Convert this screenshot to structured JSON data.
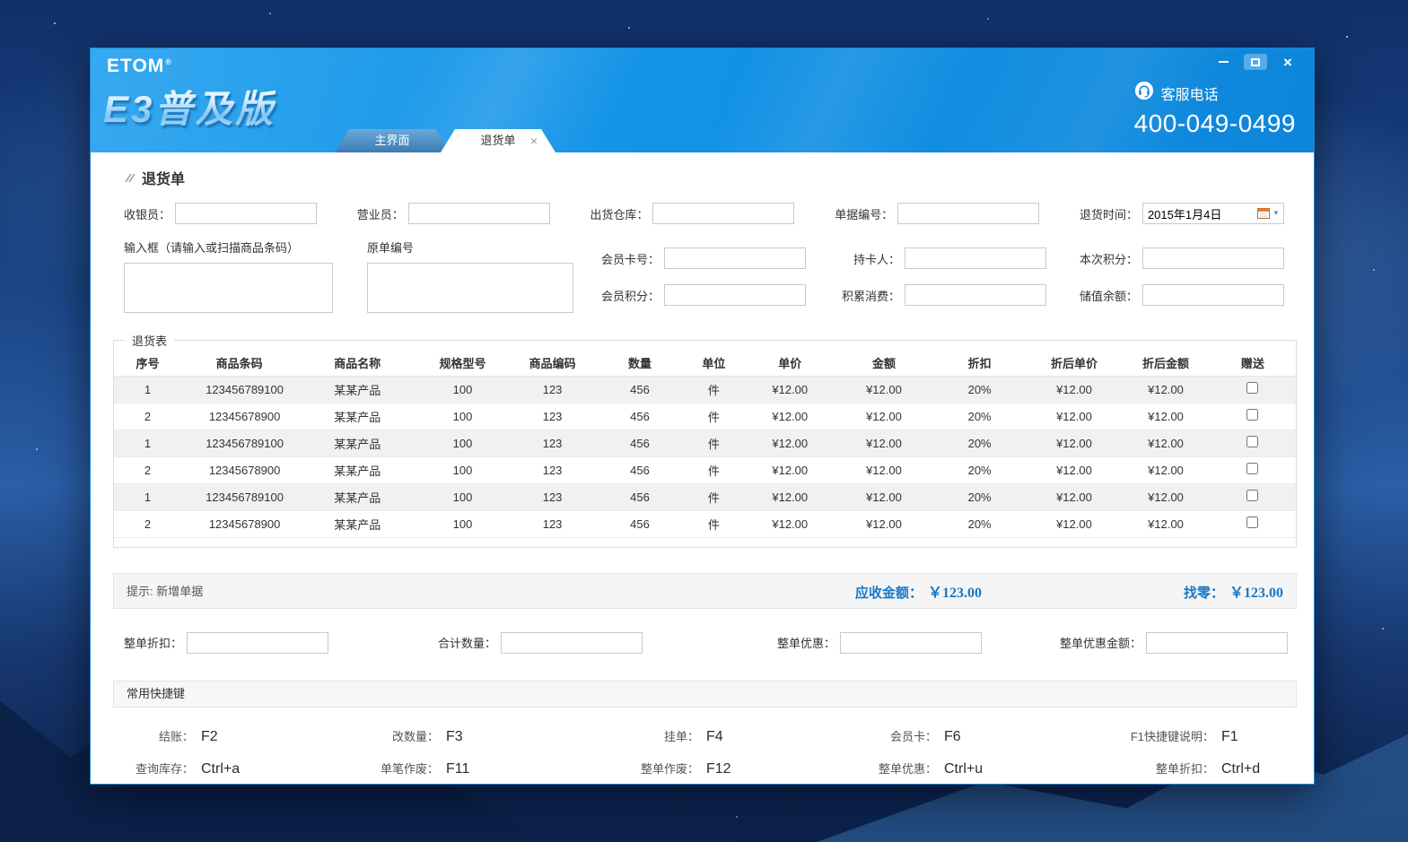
{
  "colors": {
    "header_blue": "#1494e8",
    "amount_blue": "#1779c8"
  },
  "icons": {
    "window_close": "×",
    "tab_close": "×",
    "date_caret": "▼"
  },
  "window": {
    "logo": "ETOM",
    "logo_reg": "®",
    "brand": "E3普及版",
    "service": {
      "label": "客服电话",
      "phone": "400-049-0499"
    },
    "tabs": [
      {
        "label": "主界面",
        "active": false
      },
      {
        "label": "退货单",
        "active": true
      }
    ]
  },
  "page": {
    "title": "退货单"
  },
  "form": {
    "cashier_label": "收银员：",
    "salesperson_label": "营业员：",
    "warehouse_label": "出货仓库：",
    "doc_no_label": "单据编号：",
    "return_time_label": "退货时间：",
    "return_time_value": "2015年1月4日",
    "barcode_box_label": "输入框（请输入或扫描商品条码）",
    "original_no_label": "原单编号",
    "member_card_label": "会员卡号：",
    "cardholder_label": "持卡人：",
    "current_points_label": "本次积分：",
    "member_points_label": "会员积分：",
    "accumulated_label": "积累消费：",
    "stored_balance_label": "储值余额："
  },
  "table": {
    "title": "退货表",
    "headers": [
      "序号",
      "商品条码",
      "商品名称",
      "规格型号",
      "商品编码",
      "数量",
      "单位",
      "单价",
      "金额",
      "折扣",
      "折后单价",
      "折后金额",
      "赠送"
    ],
    "rows": [
      [
        "1",
        "123456789100",
        "某某产品",
        "100",
        "123",
        "456",
        "件",
        "¥12.00",
        "¥12.00",
        "20%",
        "¥12.00",
        "¥12.00"
      ],
      [
        "2",
        "12345678900",
        "某某产品",
        "100",
        "123",
        "456",
        "件",
        "¥12.00",
        "¥12.00",
        "20%",
        "¥12.00",
        "¥12.00"
      ],
      [
        "1",
        "123456789100",
        "某某产品",
        "100",
        "123",
        "456",
        "件",
        "¥12.00",
        "¥12.00",
        "20%",
        "¥12.00",
        "¥12.00"
      ],
      [
        "2",
        "12345678900",
        "某某产品",
        "100",
        "123",
        "456",
        "件",
        "¥12.00",
        "¥12.00",
        "20%",
        "¥12.00",
        "¥12.00"
      ],
      [
        "1",
        "123456789100",
        "某某产品",
        "100",
        "123",
        "456",
        "件",
        "¥12.00",
        "¥12.00",
        "20%",
        "¥12.00",
        "¥12.00"
      ],
      [
        "2",
        "12345678900",
        "某某产品",
        "100",
        "123",
        "456",
        "件",
        "¥12.00",
        "¥12.00",
        "20%",
        "¥12.00",
        "¥12.00"
      ]
    ]
  },
  "status": {
    "hint": "提示: 新增单据",
    "receivable_label": "应收金额：",
    "receivable_value": "￥123.00",
    "change_label": "找零：",
    "change_value": "￥123.00"
  },
  "totals": {
    "order_discount_label": "整单折扣：",
    "total_qty_label": "合计数量：",
    "order_promo_label": "整单优惠：",
    "order_promo_amount_label": "整单优惠金额："
  },
  "shortcuts": {
    "title": "常用快捷键",
    "items": [
      {
        "label": "结账：",
        "key": "F2"
      },
      {
        "label": "改数量：",
        "key": "F3"
      },
      {
        "label": "挂单：",
        "key": "F4"
      },
      {
        "label": "会员卡：",
        "key": "F6"
      },
      {
        "label": "F1快捷键说明：",
        "key": "F1"
      },
      {
        "label": "查询库存：",
        "key": "Ctrl+a"
      },
      {
        "label": "单笔作废：",
        "key": "F11"
      },
      {
        "label": "整单作废：",
        "key": "F12"
      },
      {
        "label": "整单优惠：",
        "key": "Ctrl+u"
      },
      {
        "label": "整单折扣：",
        "key": "Ctrl+d"
      }
    ]
  }
}
